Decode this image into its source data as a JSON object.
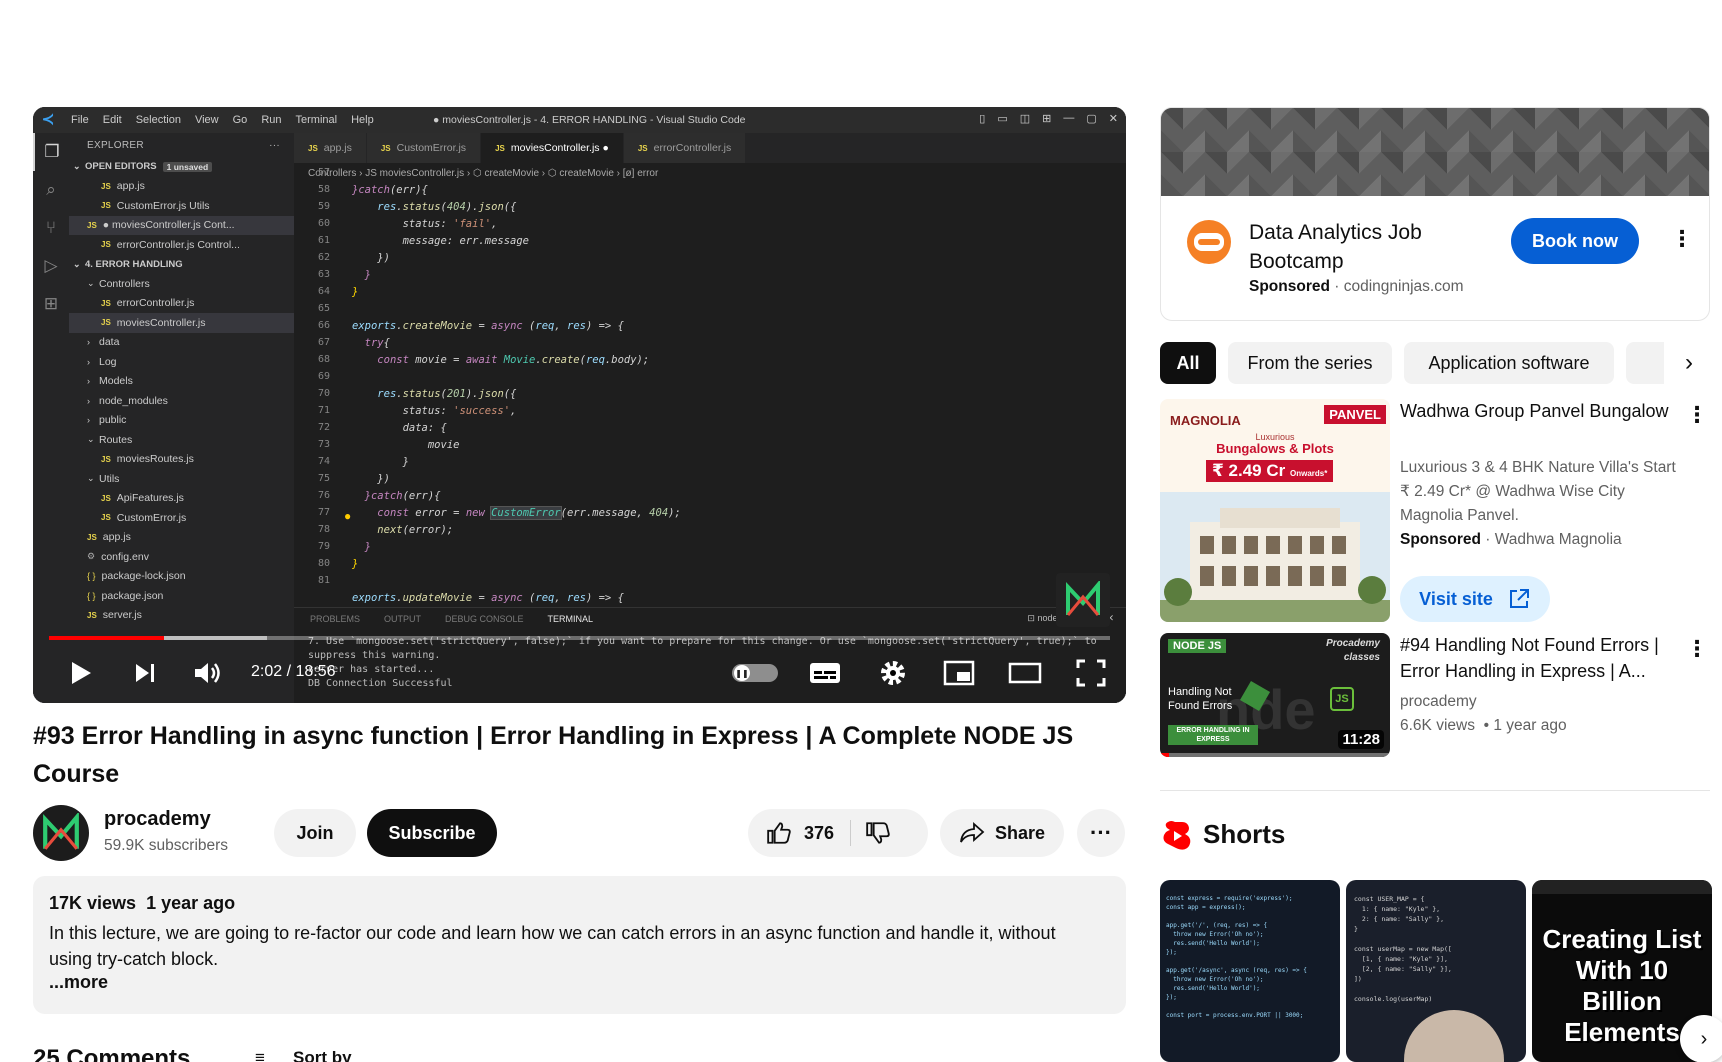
{
  "vscode": {
    "menu": [
      "File",
      "Edit",
      "Selection",
      "View",
      "Go",
      "Run",
      "Terminal",
      "Help"
    ],
    "window_title": "● moviesController.js - 4. ERROR HANDLING - Visual Studio Code",
    "explorer_label": "EXPLORER",
    "open_editors_label": "OPEN EDITORS",
    "unsaved_badge": "1 unsaved",
    "tree": [
      {
        "label": "app.js",
        "type": "js",
        "indent": 2
      },
      {
        "label": "CustomError.js  Utils",
        "type": "js",
        "indent": 2
      },
      {
        "label": "● moviesController.js  Cont...",
        "type": "js",
        "indent": 1,
        "selected": true
      },
      {
        "label": "errorController.js  Control...",
        "type": "js",
        "indent": 2
      },
      {
        "label": "4. ERROR HANDLING",
        "type": "section",
        "indent": 0
      },
      {
        "label": "Controllers",
        "type": "open",
        "indent": 1
      },
      {
        "label": "errorController.js",
        "type": "js",
        "indent": 2
      },
      {
        "label": "moviesController.js",
        "type": "js",
        "indent": 2,
        "selected": true
      },
      {
        "label": "data",
        "type": "folder",
        "indent": 1
      },
      {
        "label": "Log",
        "type": "folder",
        "indent": 1
      },
      {
        "label": "Models",
        "type": "folder",
        "indent": 1
      },
      {
        "label": "node_modules",
        "type": "folder",
        "indent": 1
      },
      {
        "label": "public",
        "type": "folder",
        "indent": 1
      },
      {
        "label": "Routes",
        "type": "open",
        "indent": 1
      },
      {
        "label": "moviesRoutes.js",
        "type": "js",
        "indent": 2
      },
      {
        "label": "Utils",
        "type": "open",
        "indent": 1
      },
      {
        "label": "ApiFeatures.js",
        "type": "js",
        "indent": 2
      },
      {
        "label": "CustomError.js",
        "type": "js",
        "indent": 2
      },
      {
        "label": "app.js",
        "type": "js",
        "indent": 1
      },
      {
        "label": "config.env",
        "type": "gear",
        "indent": 1
      },
      {
        "label": "package-lock.json",
        "type": "json",
        "indent": 1
      },
      {
        "label": "package.json",
        "type": "json",
        "indent": 1
      },
      {
        "label": "server.js",
        "type": "js",
        "indent": 1
      }
    ],
    "tabs": [
      "app.js",
      "CustomError.js",
      "moviesController.js ●",
      "errorController.js"
    ],
    "breadcrumb": "Controllers  ›  JS moviesController.js  ›  ⬡ createMovie  ›  ⬡ createMovie  ›  [ø] error",
    "line_numbers": [
      "57",
      "58",
      "59",
      "60",
      "61",
      "62",
      "63",
      "64",
      "65",
      "66",
      "67",
      "68",
      "69",
      "70",
      "71",
      "72",
      "73",
      "74",
      "75",
      "76",
      "77",
      "78",
      "79",
      "80",
      "81"
    ],
    "panel_tabs": [
      "PROBLEMS",
      "OUTPUT",
      "DEBUG CONSOLE",
      "TERMINAL"
    ],
    "panel_node": "node",
    "terminal": "7. Use `mongoose.set('strictQuery', false);` if you want to prepare for this change. Or use `mongoose.set('strictQuery', true);` to\nsuppress this warning.\nserver has started...\nDB Connection Successful"
  },
  "player": {
    "time": "2:02 / 18:56",
    "progress_played": 0.108,
    "progress_buffered": 0.205
  },
  "video": {
    "title": "#93 Error Handling in async function | Error Handling in Express | A Complete NODE JS Course",
    "channel": "procademy",
    "subscribers": "59.9K subscribers",
    "join_label": "Join",
    "subscribe_label": "Subscribe",
    "likes": "376",
    "share_label": "Share"
  },
  "description": {
    "views": "17K views",
    "age": "1 year ago",
    "text": "In this lecture, we are going to re-factor our code and learn how we can catch errors in an async function and handle it, without using try-catch block.",
    "more": "...more"
  },
  "comments": {
    "heading": "25 Comments",
    "sort_label": "Sort by"
  },
  "ad": {
    "title": "Data Analytics Job Bootcamp",
    "sponsored": "Sponsored",
    "domain": "codingninjas.com",
    "cta": "Book now"
  },
  "chips": [
    "All",
    "From the series",
    "Application software"
  ],
  "recommendations": [
    {
      "title": "Wadhwa Group Panvel Bungalow",
      "description": "Luxurious 3 & 4 BHK Nature Villa's Start ₹ 2.49 Cr* @ Wadhwa Wise City Magnolia Panvel.",
      "sponsored": "Sponsored",
      "advertiser": "Wadhwa Magnolia",
      "cta": "Visit site",
      "thumb": {
        "brand": "MAGNOLIA",
        "tag": "PANVEL",
        "sub": "Luxurious",
        "headline": "Bungalows & Plots",
        "price": "₹ 2.49 Cr",
        "price_suffix": "Onwards*"
      }
    },
    {
      "title": "#94 Handling Not Found Errors | Error Handling in Express | A...",
      "channel": "procademy",
      "views": "6.6K views",
      "age": "1 year ago",
      "duration": "11:28",
      "thumb": {
        "tag": "NODE JS",
        "brand": "Procademy",
        "brand2": "classes",
        "caption": "Handling Not Found Errors",
        "banner": "ERROR HANDLING IN EXPRESS",
        "watched": 0.04
      }
    }
  ],
  "shorts": {
    "heading": "Shorts",
    "items": [
      {
        "overlay": ""
      },
      {
        "overlay": ""
      },
      {
        "overlay": "Creating List With 10 Billion Elements"
      }
    ]
  },
  "colors": {
    "accent": "#ff0000",
    "link": "#065fd4",
    "chip_bg": "#f2f2f2"
  }
}
